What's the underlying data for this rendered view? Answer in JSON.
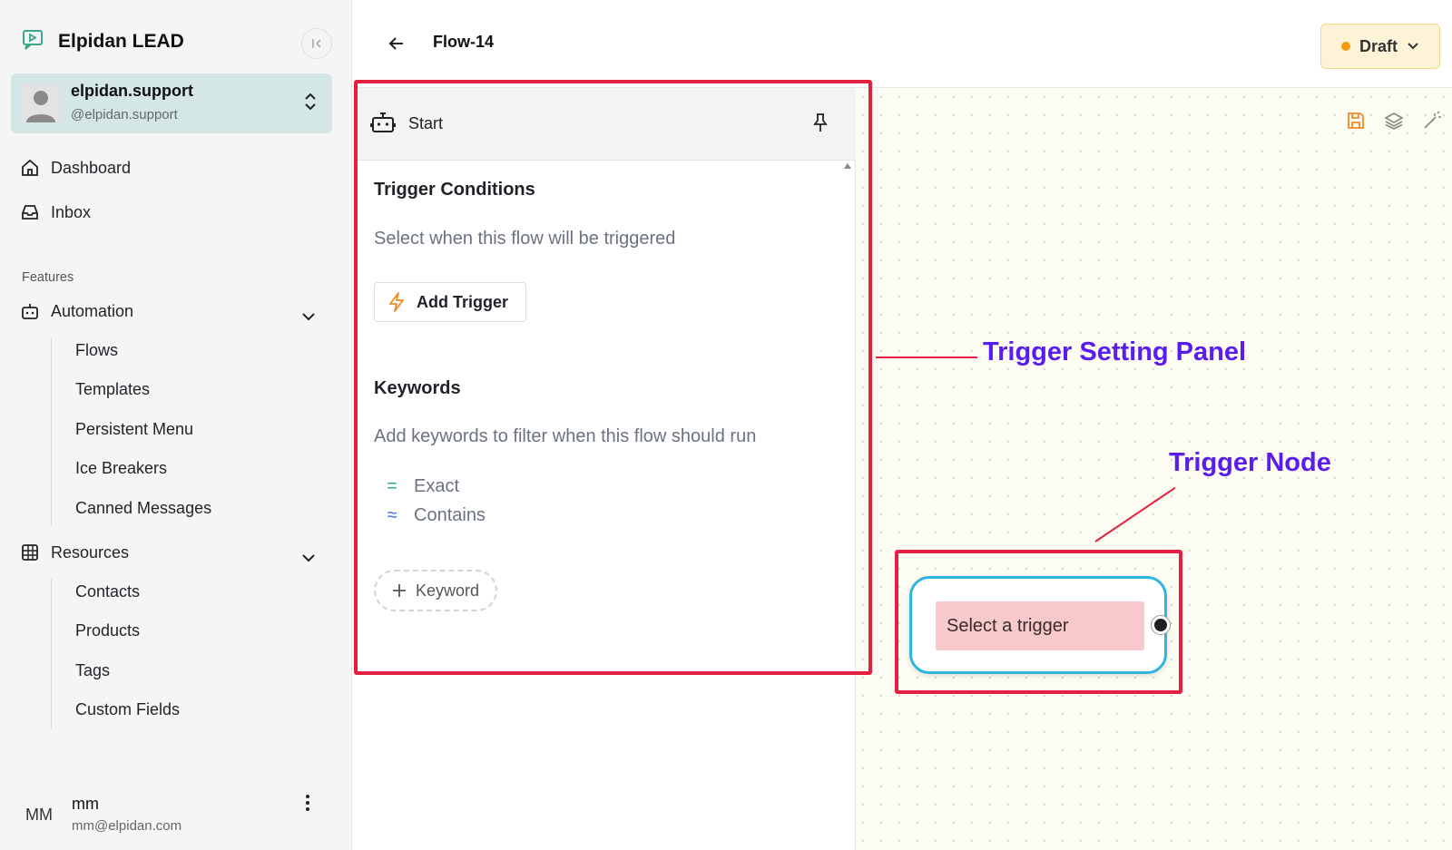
{
  "sidebar": {
    "brand": "Elpidan LEAD",
    "account": {
      "name": "elpidan.support",
      "handle": "@elpidan.support"
    },
    "nav": [
      {
        "label": "Dashboard",
        "icon": "home-icon"
      },
      {
        "label": "Inbox",
        "icon": "inbox-icon"
      }
    ],
    "section_label": "Features",
    "automation": {
      "label": "Automation",
      "items": [
        "Flows",
        "Templates",
        "Persistent Menu",
        "Ice Breakers",
        "Canned Messages"
      ]
    },
    "resources": {
      "label": "Resources",
      "items": [
        "Contacts",
        "Products",
        "Tags",
        "Custom Fields"
      ]
    },
    "user": {
      "initials": "MM",
      "name": "mm",
      "email": "mm@elpidan.com"
    }
  },
  "header": {
    "title": "Flow-14",
    "status": "Draft",
    "status_color": "#f39c12"
  },
  "panel": {
    "title": "Start",
    "trigger_conditions": {
      "heading": "Trigger Conditions",
      "description": "Select when this flow will be triggered",
      "button": "Add Trigger"
    },
    "keywords": {
      "heading": "Keywords",
      "description": "Add keywords to filter when this flow should run",
      "types": [
        {
          "symbol": "=",
          "label": "Exact",
          "color": "#2fb36b"
        },
        {
          "symbol": "≈",
          "label": "Contains",
          "color": "#3b6fe0"
        }
      ],
      "button": "Keyword"
    }
  },
  "canvas": {
    "node_label": "Select a trigger"
  },
  "annotations": {
    "panel_label": "Trigger Setting Panel",
    "node_label": "Trigger Node",
    "color": "#e3203f",
    "text_color": "#5b1cf0"
  }
}
